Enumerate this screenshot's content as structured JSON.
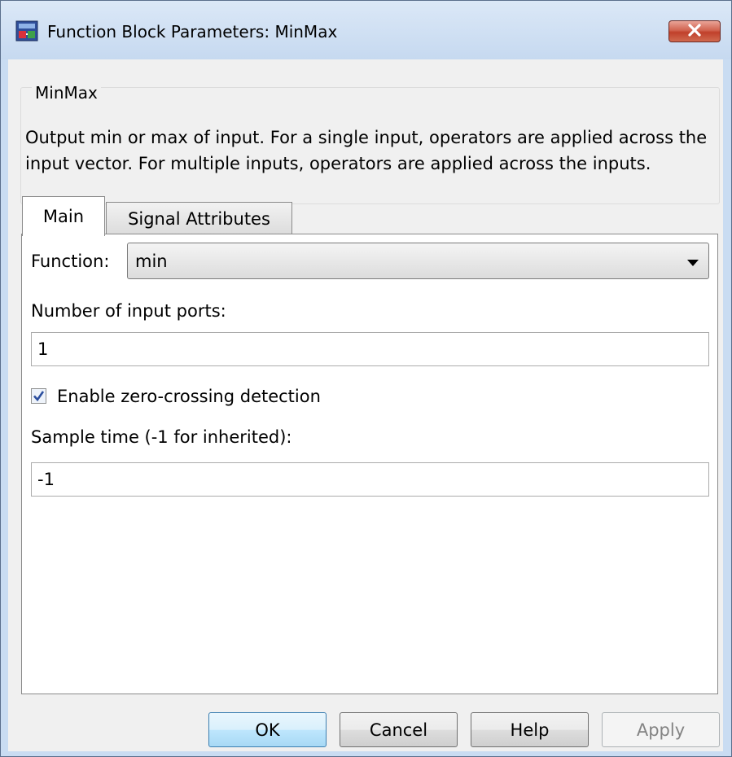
{
  "window": {
    "title": "Function Block Parameters: MinMax",
    "close_icon": "close-icon"
  },
  "description": {
    "group_label": "MinMax",
    "text": "Output min or max of input.  For a single input, operators are applied across the input vector.  For multiple inputs, operators are applied across the inputs."
  },
  "tabs": [
    {
      "label": "Main",
      "selected": true
    },
    {
      "label": "Signal Attributes",
      "selected": false
    }
  ],
  "main": {
    "function_label": "Function:",
    "function_value": "min",
    "num_ports_label": "Number of input ports:",
    "num_ports_value": "1",
    "zero_crossing_label": "Enable zero-crossing detection",
    "zero_crossing_checked": true,
    "sample_time_label": "Sample time (-1 for inherited):",
    "sample_time_value": "-1"
  },
  "buttons": {
    "ok": "OK",
    "cancel": "Cancel",
    "help": "Help",
    "apply": "Apply"
  },
  "colors": {
    "titlebar": "#c9dcf2",
    "close_button": "#c7473a",
    "ok_button": "#bee6fd",
    "checkbox_check": "#2c4f9e"
  }
}
